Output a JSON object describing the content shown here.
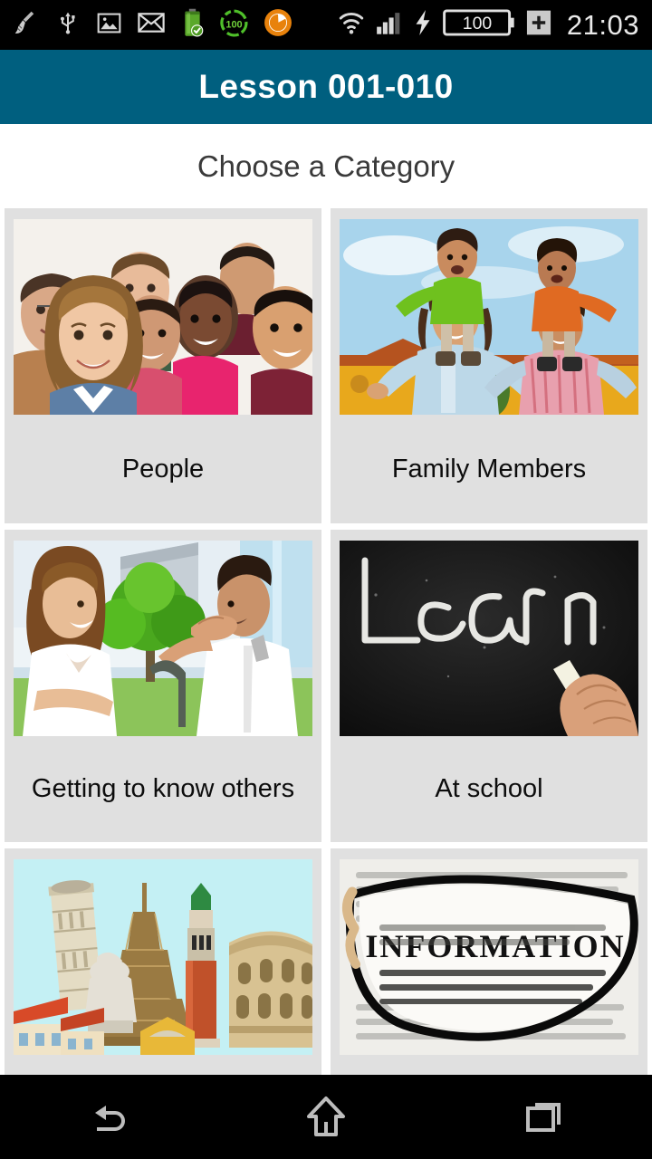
{
  "status_bar": {
    "icons_left": [
      {
        "name": "cleaner-broom-icon",
        "label": "Cleaner"
      },
      {
        "name": "usb-icon",
        "label": "USB connected"
      },
      {
        "name": "screenshot-image-icon",
        "label": "Screenshot captured"
      },
      {
        "name": "mail-icon",
        "label": "New mail"
      },
      {
        "name": "battery-full-check-icon",
        "label": "Battery full"
      },
      {
        "name": "battery-percent-100-icon",
        "label": "100"
      },
      {
        "name": "app-orange-circle-icon",
        "label": "App notification"
      }
    ],
    "icons_right": [
      {
        "name": "wifi-icon",
        "label": "Wi-Fi connected"
      },
      {
        "name": "signal-bars-icon",
        "label": "Signal strength"
      },
      {
        "name": "charging-bolt-icon",
        "label": "Charging"
      },
      {
        "name": "battery-level-icon",
        "label": "100"
      },
      {
        "name": "battery-plus-icon",
        "label": "+"
      }
    ],
    "battery_level_text": "100",
    "battery_plus_text": "+",
    "circle_badge_text": "100",
    "clock": "21:03"
  },
  "title_bar": {
    "title": "Lesson 001-010",
    "background_color": "#005F7F",
    "text_color": "#FFFFFF"
  },
  "section": {
    "header": "Choose a Category"
  },
  "grid": {
    "card_background": "#E0E0E0",
    "label_color": "#0D0D0D",
    "cards": [
      {
        "label": "People",
        "image_name": "group-of-smiling-people-photo",
        "image_alt": "Group of diverse smiling young people posing together on a white background"
      },
      {
        "label": "Family Members",
        "image_name": "family-with-children-photo",
        "image_alt": "Smiling mother and father carrying two children on their shoulders outside a yellow house under a blue sky"
      },
      {
        "label": "Getting to know others",
        "image_name": "couple-talking-outdoors-photo",
        "image_alt": "A woman and a man smiling and talking to each other outdoors near green trees"
      },
      {
        "label": "At school",
        "image_name": "learn-chalkboard-photo",
        "image_alt": "The word Learn written in white chalk on a black chalkboard with a hand holding a piece of chalk"
      },
      {
        "label": "",
        "image_name": "european-landmarks-photo",
        "image_alt": "Collage of European landmarks including the Leaning Tower of Pisa, Eiffel Tower, St Mark's Campanile and the Colosseum on a pale blue sky"
      },
      {
        "label": "",
        "image_name": "information-eyeglasses-photo",
        "image_alt": "Eyeglass lens magnifying the printed word INFORMATION on a page of text"
      }
    ]
  },
  "nav_bar": {
    "buttons": [
      {
        "name": "back-button",
        "label": "Back"
      },
      {
        "name": "home-button",
        "label": "Home"
      },
      {
        "name": "recents-button",
        "label": "Recent apps"
      }
    ]
  }
}
